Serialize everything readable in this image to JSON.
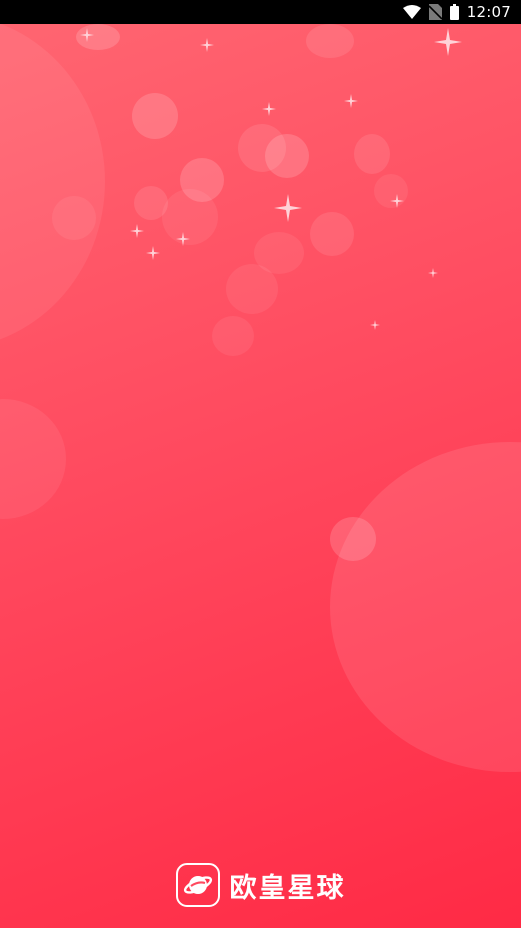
{
  "status_bar": {
    "time": "12:07",
    "icons": [
      "wifi-icon",
      "no-sim-icon",
      "battery-icon"
    ]
  },
  "splash": {
    "background_colors": [
      "#ff6571",
      "#ff4a5f",
      "#ff2a45"
    ],
    "brand": {
      "name": "欧皇星球",
      "logo_icon": "planet-logo-icon"
    }
  }
}
